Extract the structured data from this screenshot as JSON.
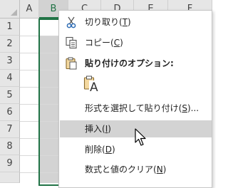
{
  "sheet": {
    "columns": [
      "A",
      "B",
      "C",
      "D",
      "E",
      "F"
    ],
    "rows": [
      "1",
      "2",
      "3",
      "4",
      "5",
      "6",
      "7",
      "8",
      "9"
    ],
    "selected_column": "B",
    "colors": {
      "selection_border": "#217346",
      "selection_fill": "#d3d3d3",
      "header_bg": "#e6e6e6"
    }
  },
  "context_menu": {
    "cut": {
      "text": "切り取り(",
      "key": "T",
      "end": ")",
      "icon": "scissors-icon"
    },
    "copy": {
      "text": "コピー(",
      "key": "C",
      "end": ")",
      "icon": "copy-icon"
    },
    "paste_options": {
      "label": "貼り付けのオプション:",
      "icon": "clipboard-icon",
      "option_icon": "paste-format-icon",
      "option_glyph": "A"
    },
    "paste_special": {
      "text": "形式を選択して貼り付け(",
      "key": "S",
      "end": ")..."
    },
    "insert": {
      "text": "挿入(",
      "key": "I",
      "end": ")"
    },
    "delete": {
      "text": "削除(",
      "key": "D",
      "end": ")"
    },
    "clear": {
      "text": "数式と値のクリア(",
      "key": "N",
      "end": ")"
    },
    "hover_color": "#d3d3d3"
  }
}
